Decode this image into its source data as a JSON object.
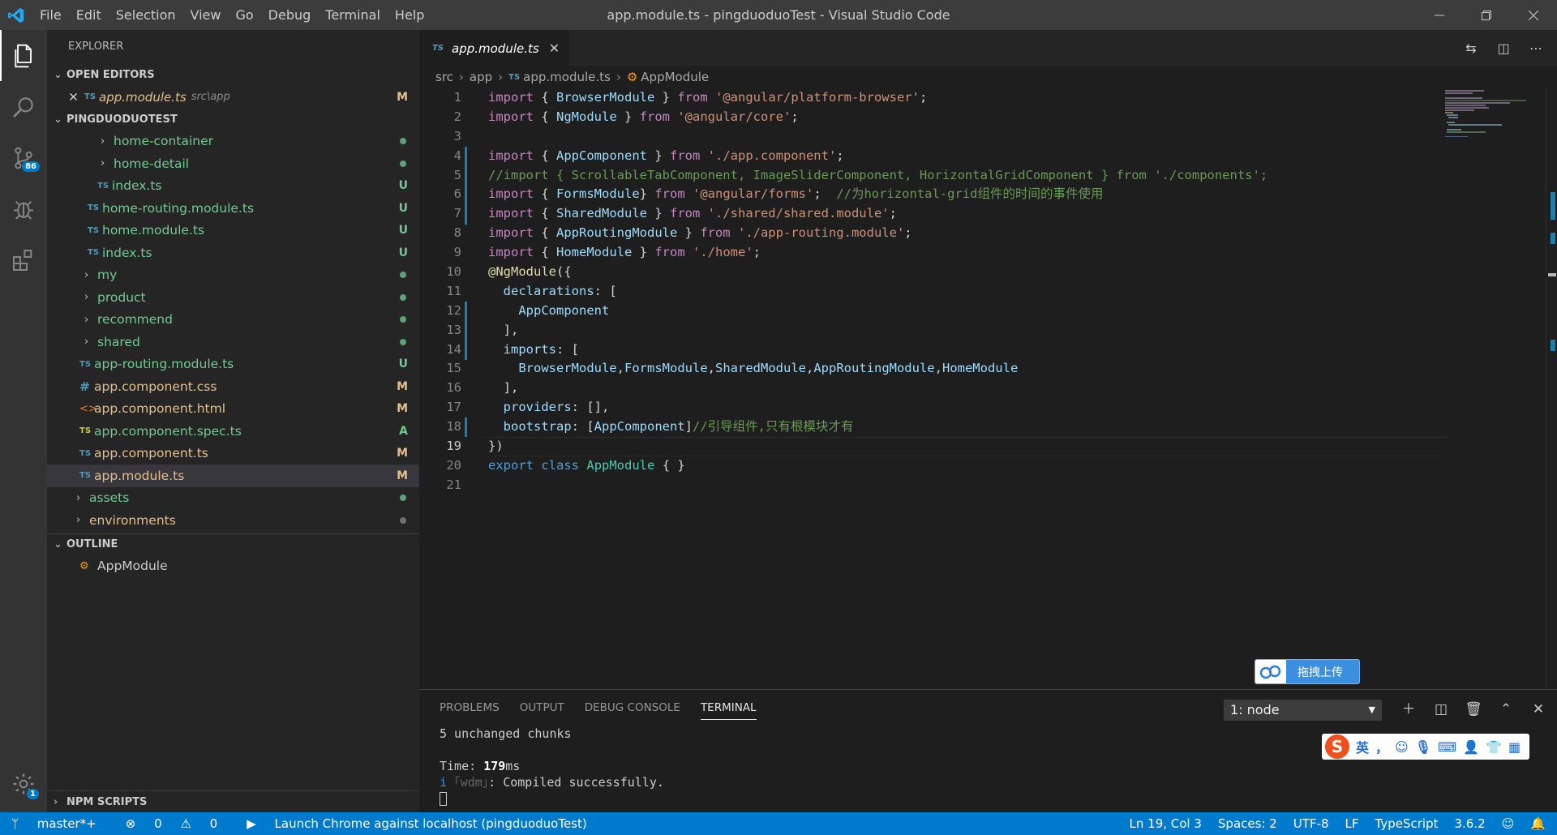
{
  "window": {
    "title": "app.module.ts - pingduoduoTest - Visual Studio Code",
    "menu": [
      "File",
      "Edit",
      "Selection",
      "View",
      "Go",
      "Debug",
      "Terminal",
      "Help"
    ]
  },
  "activity": {
    "scm_badge": "86",
    "settings_badge": "1"
  },
  "sidebar": {
    "title": "EXPLORER",
    "open_editors": {
      "header": "OPEN EDITORS",
      "item": {
        "icon": "TS",
        "name": "app.module.ts",
        "path": "src\\app",
        "status": "M"
      }
    },
    "project": {
      "header": "PINGDUODUOTEST",
      "items": [
        {
          "name": "home-container",
          "kind": "folder",
          "status": ""
        },
        {
          "name": "home-detail",
          "kind": "folder",
          "status": ""
        },
        {
          "name": "index.ts",
          "kind": "ts",
          "status": "U"
        },
        {
          "name": "home-routing.module.ts",
          "kind": "ts",
          "status": "U"
        },
        {
          "name": "home.module.ts",
          "kind": "ts",
          "status": "U"
        },
        {
          "name": "index.ts",
          "kind": "ts",
          "status": "U"
        },
        {
          "name": "my",
          "kind": "folder",
          "status": ""
        },
        {
          "name": "product",
          "kind": "folder",
          "status": ""
        },
        {
          "name": "recommend",
          "kind": "folder",
          "status": ""
        },
        {
          "name": "shared",
          "kind": "folder",
          "status": ""
        },
        {
          "name": "app-routing.module.ts",
          "kind": "ts",
          "status": "U"
        },
        {
          "name": "app.component.css",
          "kind": "css",
          "status": "M"
        },
        {
          "name": "app.component.html",
          "kind": "html",
          "status": "M"
        },
        {
          "name": "app.component.spec.ts",
          "kind": "ts",
          "status": "A"
        },
        {
          "name": "app.component.ts",
          "kind": "ts",
          "status": "M"
        },
        {
          "name": "app.module.ts",
          "kind": "ts",
          "status": "M"
        },
        {
          "name": "assets",
          "kind": "folder",
          "status": ""
        },
        {
          "name": "environments",
          "kind": "folder",
          "status": ""
        }
      ]
    },
    "outline": {
      "header": "OUTLINE",
      "item": "AppModule"
    },
    "npm": {
      "header": "NPM SCRIPTS"
    }
  },
  "editor": {
    "tab": {
      "icon": "TS",
      "label": "app.module.ts"
    },
    "breadcrumb": [
      "src",
      "app",
      "app.module.ts",
      "AppModule"
    ],
    "breadcrumb_ts_icon": "TS",
    "line_numbers": [
      "1",
      "2",
      "3",
      "4",
      "5",
      "6",
      "7",
      "8",
      "9",
      "10",
      "11",
      "12",
      "13",
      "14",
      "15",
      "16",
      "17",
      "18",
      "19",
      "20",
      "21"
    ],
    "code": {
      "l1": [
        "import",
        " { ",
        "BrowserModule",
        " } ",
        "from",
        " ",
        "'@angular/platform-browser'",
        ";"
      ],
      "l2": [
        "import",
        " { ",
        "NgModule",
        " } ",
        "from",
        " ",
        "'@angular/core'",
        ";"
      ],
      "l4": [
        "import",
        " { ",
        "AppComponent",
        " } ",
        "from",
        " ",
        "'./app.component'",
        ";"
      ],
      "l5": "//import { ScrollableTabComponent, ImageSliderComponent, HorizontalGridComponent } from './components';",
      "l6": [
        "import",
        " { ",
        "FormsModule",
        "} ",
        "from",
        " ",
        "'@angular/forms'",
        ";  ",
        "//为horizontal-grid组件的时间的事件使用"
      ],
      "l7": [
        "import",
        " { ",
        "SharedModule",
        " } ",
        "from",
        " ",
        "'./shared/shared.module'",
        ";"
      ],
      "l8": [
        "import",
        " { ",
        "AppRoutingModule",
        " } ",
        "from",
        " ",
        "'./app-routing.module'",
        ";"
      ],
      "l9": [
        "import",
        " { ",
        "HomeModule",
        " } ",
        "from",
        " ",
        "'./home'",
        ";"
      ],
      "l10": [
        "@NgModule",
        "({"
      ],
      "l11": [
        "  ",
        "declarations",
        ": ["
      ],
      "l12": [
        "    ",
        "AppComponent"
      ],
      "l13": "  ],",
      "l14": [
        "  ",
        "imports",
        ": ["
      ],
      "l15": [
        "    ",
        "BrowserModule",
        ",",
        "FormsModule",
        ",",
        "SharedModule",
        ",",
        "AppRoutingModule",
        ",",
        "HomeModule"
      ],
      "l16": "  ],",
      "l17": [
        "  ",
        "providers",
        ": [],"
      ],
      "l18": [
        "  ",
        "bootstrap",
        ": [",
        "AppComponent",
        "]",
        "//引导组件,只有根模块才有"
      ],
      "l19": "})",
      "l20": [
        "export",
        " ",
        "class",
        " ",
        "AppModule",
        " { }"
      ]
    }
  },
  "panel": {
    "tabs": [
      "PROBLEMS",
      "OUTPUT",
      "DEBUG CONSOLE",
      "TERMINAL"
    ],
    "terminal_select": "1: node",
    "terminal": {
      "line1": "5 unchanged chunks",
      "time_label": "Time: ",
      "time_value": "179",
      "time_unit": "ms",
      "info_icon": "i",
      "wdm_tag": "｢wdm｣",
      "compiled": ": Compiled successfully."
    }
  },
  "status": {
    "branch": "master*+",
    "errors": "0",
    "warnings": "0",
    "launch": "Launch Chrome against localhost (pingduoduoTest)",
    "position": "Ln 19, Col 3",
    "spaces": "Spaces: 2",
    "encoding": "UTF-8",
    "eol": "LF",
    "language": "TypeScript",
    "version": "3.6.2"
  },
  "overlay": {
    "upload_label": "拖拽上传",
    "ime_lang": "英",
    "ime_punct": "，",
    "ime_logo": "S"
  }
}
